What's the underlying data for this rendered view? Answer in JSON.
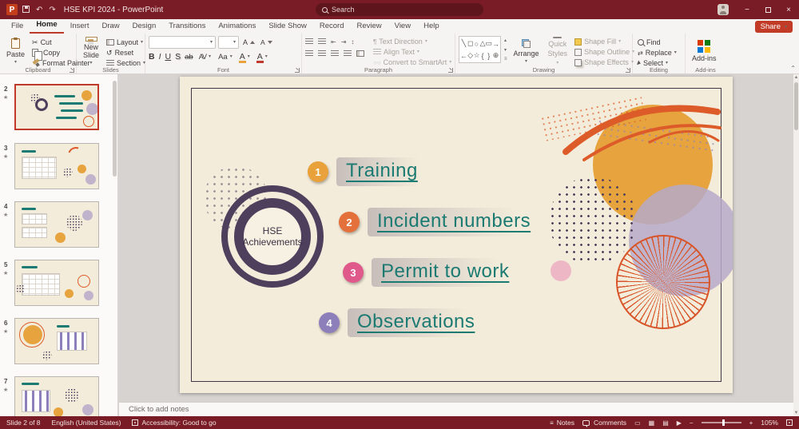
{
  "titlebar": {
    "title": "HSE KPI 2024  -  PowerPoint",
    "search_placeholder": "Search"
  },
  "tabs": [
    "File",
    "Home",
    "Insert",
    "Draw",
    "Design",
    "Transitions",
    "Animations",
    "Slide Show",
    "Record",
    "Review",
    "View",
    "Help"
  ],
  "active_tab": "Home",
  "share_label": "Share",
  "ribbon": {
    "groups": {
      "clipboard": "Clipboard",
      "slides": "Slides",
      "font": "Font",
      "paragraph": "Paragraph",
      "drawing": "Drawing",
      "editing": "Editing",
      "addins": "Add-ins"
    },
    "clipboard": {
      "paste": "Paste",
      "cut": "Cut",
      "copy": "Copy",
      "format_painter": "Format Painter"
    },
    "slides": {
      "new_slide": "New Slide",
      "layout": "Layout",
      "reset": "Reset",
      "section": "Section"
    },
    "font": {
      "bold": "B",
      "italic": "I",
      "underline": "U",
      "shadow": "S",
      "strike": "ab",
      "spacing": "AV",
      "case": "Aa",
      "grow": "A",
      "shrink": "A",
      "highlight": "A",
      "color": "A"
    },
    "paragraph": {
      "text_direction": "Text Direction",
      "align_text": "Align Text",
      "smartart": "Convert to SmartArt"
    },
    "drawing": {
      "arrange": "Arrange",
      "quick1": "Quick",
      "quick2": "Styles",
      "shape_fill": "Shape Fill",
      "shape_outline": "Shape Outline",
      "shape_effects": "Shape Effects"
    },
    "editing": {
      "find": "Find",
      "replace": "Replace",
      "select": "Select"
    },
    "addins": {
      "label": "Add-ins"
    }
  },
  "thumbnails": [
    {
      "number": "2",
      "selected": true
    },
    {
      "number": "3",
      "selected": false
    },
    {
      "number": "4",
      "selected": false
    },
    {
      "number": "5",
      "selected": false
    },
    {
      "number": "6",
      "selected": false
    },
    {
      "number": "7",
      "selected": false
    }
  ],
  "slide": {
    "hub_line1": "HSE",
    "hub_line2": "Achievements",
    "text_color": "#1b7a72",
    "items": [
      {
        "num": "1",
        "label": "Training",
        "color": "#e9a23b"
      },
      {
        "num": "2",
        "label": "Incident numbers",
        "color": "#e4703b"
      },
      {
        "num": "3",
        "label": "Permit to work",
        "color": "#e0598b"
      },
      {
        "num": "4",
        "label": "Observations",
        "color": "#8d7fba"
      }
    ]
  },
  "notes_placeholder": "Click to add notes",
  "statusbar": {
    "slide_info": "Slide 2 of 8",
    "language": "English (United States)",
    "accessibility": "Accessibility: Good to go",
    "notes": "Notes",
    "comments": "Comments",
    "zoom": "105%"
  },
  "colors": {
    "titlebar": "#7a1c25",
    "share_button": "#c13b27",
    "slide_background": "#f4ecda",
    "hub_purple": "#4e3f5d",
    "teal_text": "#1b7a72",
    "mustard": "#e6a33e",
    "orange": "#dd5b28",
    "lavender": "#b5aac8"
  }
}
